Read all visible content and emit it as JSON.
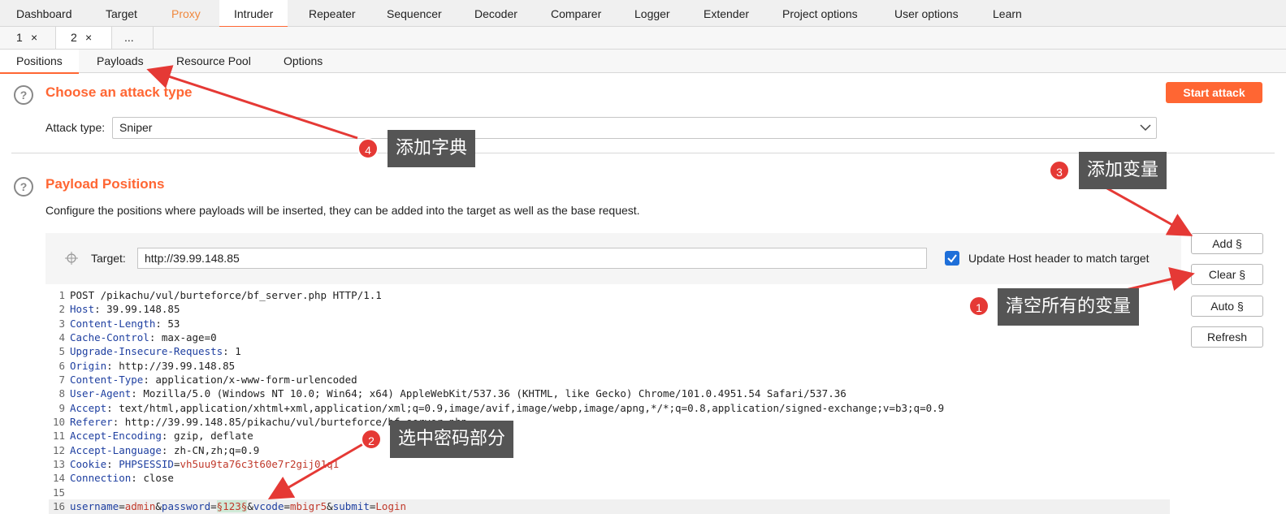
{
  "top_tabs": [
    "Dashboard",
    "Target",
    "Proxy",
    "Intruder",
    "Repeater",
    "Sequencer",
    "Decoder",
    "Comparer",
    "Logger",
    "Extender",
    "Project options",
    "User options",
    "Learn"
  ],
  "sub_tabs": [
    {
      "label": "1",
      "close": "×"
    },
    {
      "label": "2",
      "close": "×"
    },
    {
      "label": "..."
    }
  ],
  "inner_tabs": [
    "Positions",
    "Payloads",
    "Resource Pool",
    "Options"
  ],
  "attack": {
    "title": "Choose an attack type",
    "label": "Attack type:",
    "value": "Sniper",
    "start": "Start attack",
    "help": "?"
  },
  "positions": {
    "title": "Payload Positions",
    "desc": "Configure the positions where payloads will be inserted, they can be added into the target as well as the base request.",
    "help": "?",
    "target_label": "Target:",
    "target_value": "http://39.99.148.85",
    "update_host": "Update Host header to match target"
  },
  "side_buttons": [
    "Add §",
    "Clear §",
    "Auto §",
    "Refresh"
  ],
  "request_lines": [
    {
      "n": "1",
      "key": "POST /pikachu/vul/burteforce/bf_server.php HTTP/1.1",
      "val": ""
    },
    {
      "n": "2",
      "key": "Host",
      "val": ": 39.99.148.85"
    },
    {
      "n": "3",
      "key": "Content-Length",
      "val": ": 53"
    },
    {
      "n": "4",
      "key": "Cache-Control",
      "val": ": max-age=0"
    },
    {
      "n": "5",
      "key": "Upgrade-Insecure-Requests",
      "val": ": 1"
    },
    {
      "n": "6",
      "key": "Origin",
      "val": ": http://39.99.148.85"
    },
    {
      "n": "7",
      "key": "Content-Type",
      "val": ": application/x-www-form-urlencoded"
    },
    {
      "n": "8",
      "key": "User-Agent",
      "val": ": Mozilla/5.0 (Windows NT 10.0; Win64; x64) AppleWebKit/537.36 (KHTML, like Gecko) Chrome/101.0.4951.54 Safari/537.36"
    },
    {
      "n": "9",
      "key": "Accept",
      "val": ": text/html,application/xhtml+xml,application/xml;q=0.9,image/avif,image/webp,image/apng,*/*;q=0.8,application/signed-exchange;v=b3;q=0.9"
    },
    {
      "n": "10",
      "key": "Referer",
      "val": ": http://39.99.148.85/pikachu/vul/burteforce/bf_server.php"
    },
    {
      "n": "11",
      "key": "Accept-Encoding",
      "val": ": gzip, deflate"
    },
    {
      "n": "12",
      "key": "Accept-Language",
      "val": ": zh-CN,zh;q=0.9"
    },
    {
      "n": "13",
      "key": "Cookie",
      "val": ": "
    },
    {
      "n": "14",
      "key": "Connection",
      "val": ": close"
    },
    {
      "n": "15",
      "key": "",
      "val": ""
    }
  ],
  "cookie": {
    "name": "PHPSESSID",
    "eq": "=",
    "value": "vh5uu9ta76c3t60e7r2gij01q1"
  },
  "body_line": {
    "n": "16",
    "p1k": "username",
    "p1v": "admin",
    "p2k": "password",
    "payload": "§123§",
    "p3k": "vcode",
    "p3v": "mbigr5",
    "p4k": "submit",
    "p4v": "Login",
    "eq": "=",
    "amp": "&"
  },
  "callouts": [
    {
      "num": "1",
      "text": "清空所有的变量"
    },
    {
      "num": "2",
      "text": "选中密码部分"
    },
    {
      "num": "3",
      "text": "添加变量"
    },
    {
      "num": "4",
      "text": "添加字典"
    }
  ]
}
